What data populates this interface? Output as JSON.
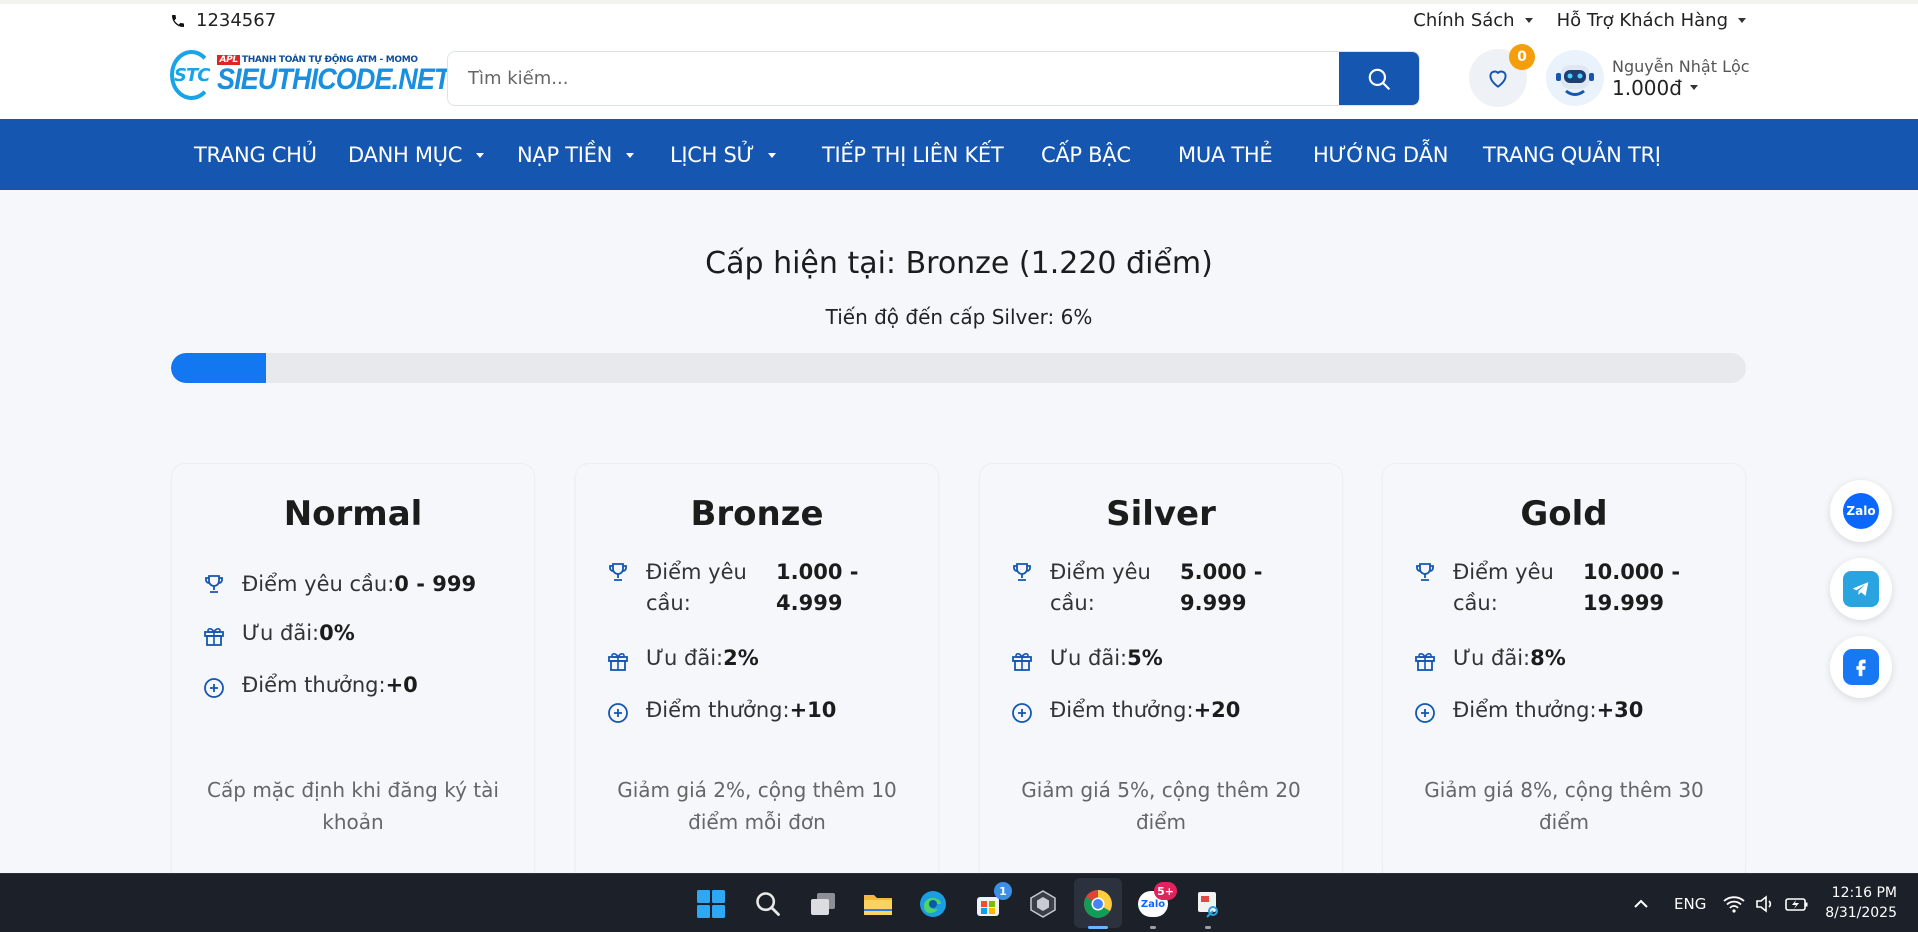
{
  "topbar": {
    "phone": "1234567",
    "links": [
      "Chính Sách",
      "Hỗ Trợ Khách Hàng"
    ]
  },
  "logo": {
    "tag": "APL",
    "tagline": "THANH TOÁN TỰ ĐỘNG ATM - MOMO",
    "mark": "STC",
    "name": "SIEUTHICODE.NET"
  },
  "search": {
    "placeholder": "Tìm kiếm..."
  },
  "wishlist": {
    "count": "0"
  },
  "user": {
    "name": "Nguyễn Nhật Lộc",
    "balance": "1.000đ"
  },
  "nav": {
    "items": [
      {
        "label": "TRANG CHỦ",
        "dropdown": false
      },
      {
        "label": "DANH MỤC",
        "dropdown": true
      },
      {
        "label": "NẠP TIỀN",
        "dropdown": true
      },
      {
        "label": "LỊCH SỬ",
        "dropdown": true
      },
      {
        "label": "TIẾP THỊ LIÊN KẾT",
        "dropdown": false
      },
      {
        "label": "CẤP BẬC",
        "dropdown": false
      },
      {
        "label": "MUA THẺ",
        "dropdown": false
      },
      {
        "label": "HƯỚNG DẪN",
        "dropdown": false
      },
      {
        "label": "TRANG QUẢN TRỊ",
        "dropdown": false
      }
    ]
  },
  "level": {
    "title": "Cấp hiện tại: Bronze (1.220 điểm)",
    "progress_text": "Tiến độ đến cấp Silver: 6%",
    "progress_percent": 6
  },
  "tiers": [
    {
      "name": "Normal",
      "points_label": "Điểm yêu cầu:",
      "points_value": "0 - 999",
      "discount_label": "Ưu đãi:",
      "discount_value": "0%",
      "bonus_label": "Điểm thưởng:",
      "bonus_value": "+0",
      "description": "Cấp mặc định khi đăng ký tài khoản"
    },
    {
      "name": "Bronze",
      "points_label": "Điểm yêu cầu:",
      "points_value": "1.000 - 4.999",
      "discount_label": "Ưu đãi:",
      "discount_value": "2%",
      "bonus_label": "Điểm thưởng:",
      "bonus_value": "+10",
      "description": "Giảm giá 2%, cộng thêm 10 điểm mỗi đơn"
    },
    {
      "name": "Silver",
      "points_label": "Điểm yêu cầu:",
      "points_value": "5.000 - 9.999",
      "discount_label": "Ưu đãi:",
      "discount_value": "5%",
      "bonus_label": "Điểm thưởng:",
      "bonus_value": "+20",
      "description": "Giảm giá 5%, cộng thêm 20 điểm"
    },
    {
      "name": "Gold",
      "points_label": "Điểm yêu cầu:",
      "points_value": "10.000 - 19.999",
      "discount_label": "Ưu đãi:",
      "discount_value": "8%",
      "bonus_label": "Điểm thưởng:",
      "bonus_value": "+30",
      "description": "Giảm giá 8%, cộng thêm 30 điểm"
    }
  ],
  "social": {
    "zalo_label": "Zalo"
  },
  "taskbar": {
    "store_badge": "1",
    "zalo_badge": "5+",
    "zalo_label": "Zalo",
    "lang": "ENG",
    "time": "12:16 PM",
    "date": "8/31/2025"
  },
  "colors": {
    "primary": "#1557b0",
    "progress": "#1377f2",
    "badge": "#f59e0b"
  }
}
